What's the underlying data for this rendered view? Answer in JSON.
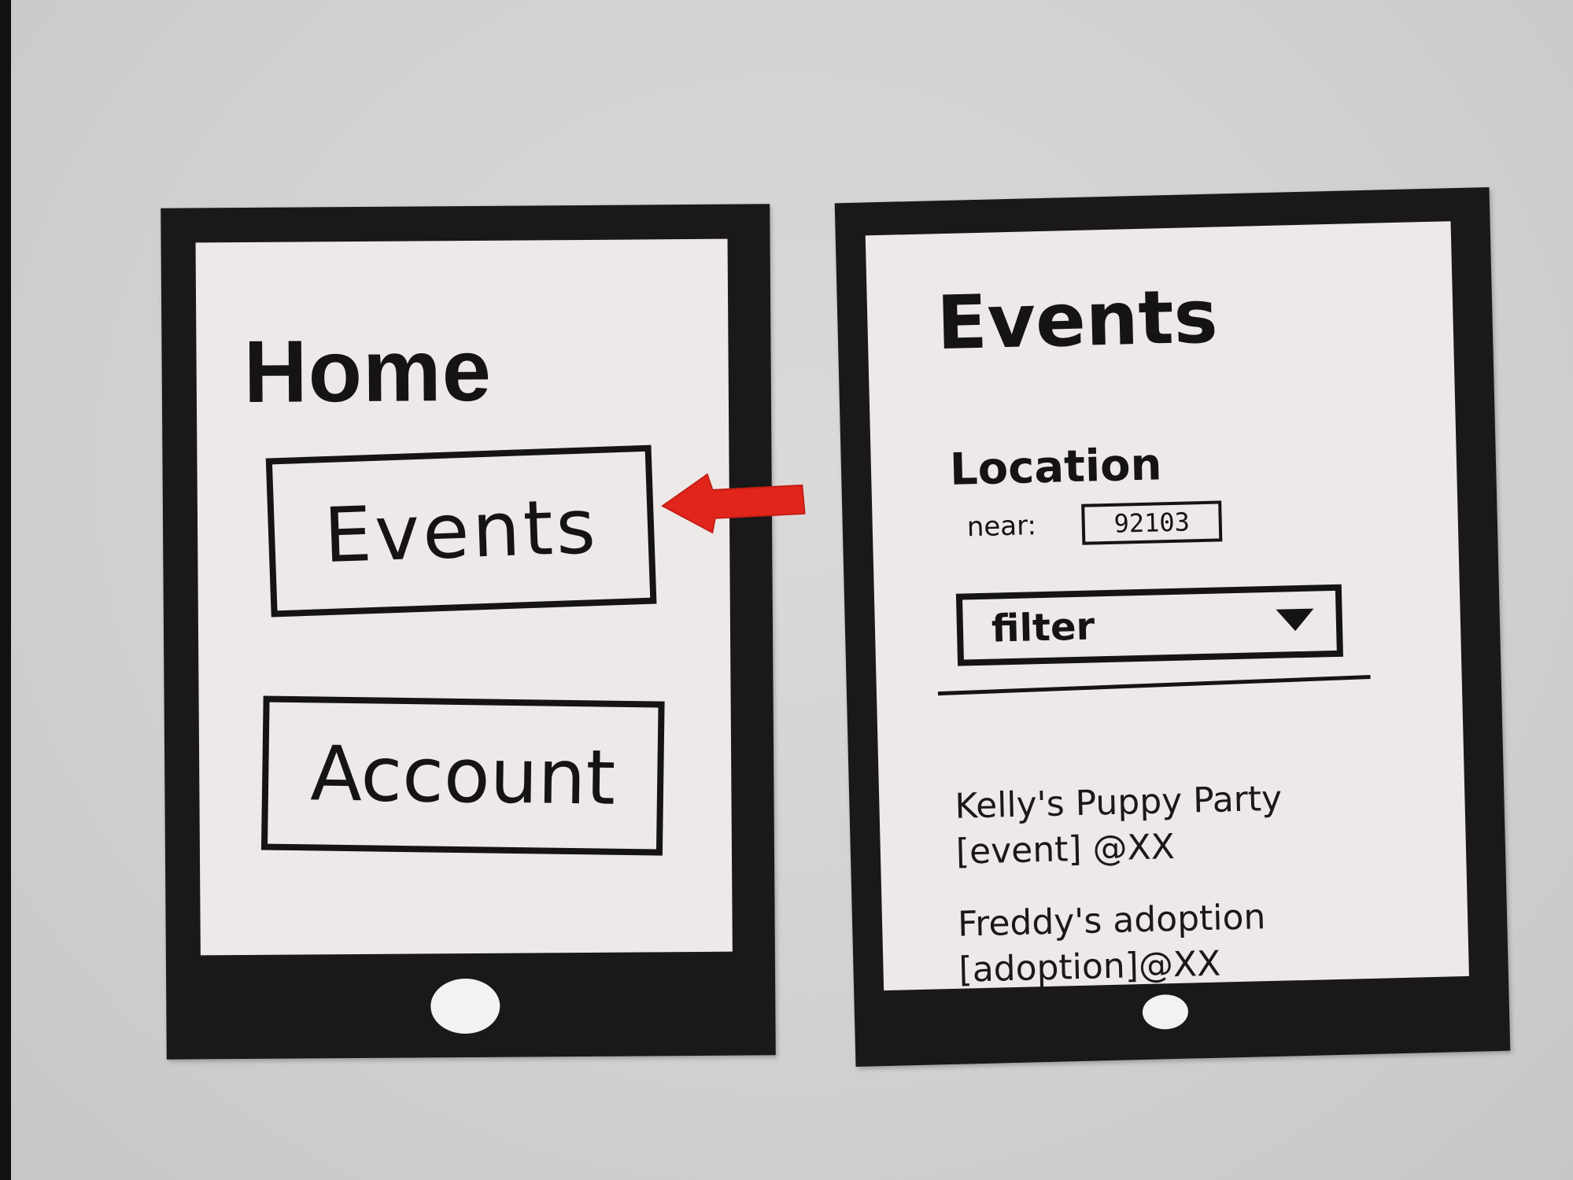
{
  "home_screen": {
    "title": "Home",
    "buttons": {
      "events": "Events",
      "account": "Account"
    }
  },
  "events_screen": {
    "title": "Events",
    "location": {
      "label": "Location",
      "near_label": "near:",
      "zip_value": "92103"
    },
    "filter": {
      "label": "filter"
    },
    "events": [
      {
        "name": "Kelly's Puppy Party",
        "detail": "[event] @XX"
      },
      {
        "name": "Freddy's adoption",
        "detail": "[adoption]@XX"
      }
    ]
  },
  "colors": {
    "ink": "#151313",
    "paper": "#ece9e8",
    "arrow": "#e2251b"
  }
}
